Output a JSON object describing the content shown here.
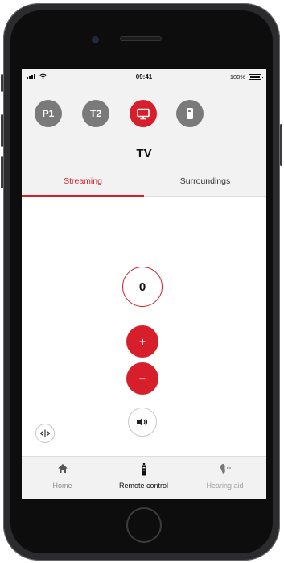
{
  "status_bar": {
    "time": "09:41",
    "battery_pct": "100%"
  },
  "programs": [
    {
      "label": "P1",
      "type": "text",
      "active": false
    },
    {
      "label": "T2",
      "type": "text",
      "active": false
    },
    {
      "icon": "tv-icon",
      "type": "icon",
      "active": true
    },
    {
      "icon": "remote-icon",
      "type": "icon",
      "active": false
    }
  ],
  "current_program": "TV",
  "tabs": [
    {
      "label": "Streaming",
      "active": true
    },
    {
      "label": "Surroundings",
      "active": false
    }
  ],
  "volume": {
    "value": "0",
    "increase_symbol": "+",
    "decrease_symbol": "−"
  },
  "nav": [
    {
      "label": "Home",
      "icon": "home-icon"
    },
    {
      "label": "Remote control",
      "icon": "remote-icon",
      "active": true
    },
    {
      "label": "Hearing aid",
      "icon": "hearing-aid-icon"
    }
  ],
  "colors": {
    "accent": "#d71f2c",
    "inactive_program": "#7a7a7a",
    "header_bg": "#f2f2f2"
  }
}
